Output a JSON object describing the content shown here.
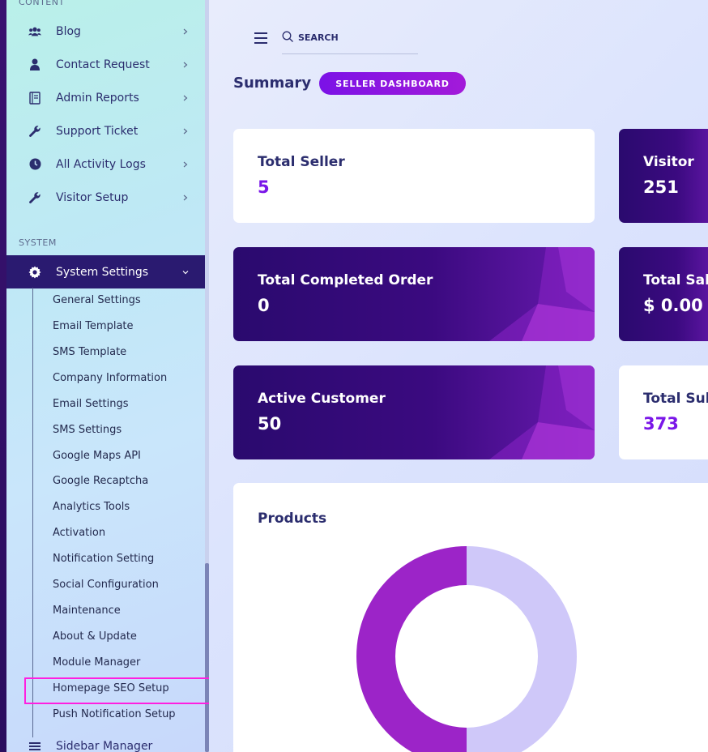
{
  "sidebar": {
    "content_label": "CONTENT",
    "system_label": "SYSTEM",
    "items": [
      {
        "label": "Blog",
        "icon": "users-icon"
      },
      {
        "label": "Contact Request",
        "icon": "user-icon"
      },
      {
        "label": "Admin Reports",
        "icon": "report-icon"
      },
      {
        "label": "Support Ticket",
        "icon": "wrench-icon"
      },
      {
        "label": "All Activity Logs",
        "icon": "clock-icon"
      },
      {
        "label": "Visitor Setup",
        "icon": "wrench-icon"
      }
    ],
    "system_settings": {
      "label": "System Settings",
      "icon": "gear-icon"
    },
    "sub_items": [
      "General Settings",
      "Email Template",
      "SMS Template",
      "Company Information",
      "Email Settings",
      "SMS Settings",
      "Google Maps API",
      "Google Recaptcha",
      "Analytics Tools",
      "Activation",
      "Notification Setting",
      "Social Configuration",
      "Maintenance",
      "About & Update",
      "Module Manager",
      "Homepage SEO Setup",
      "Push Notification Setup"
    ],
    "sidebar_manager": {
      "label": "Sidebar Manager",
      "icon": "menu-icon"
    }
  },
  "header": {
    "search_placeholder": "SEARCH"
  },
  "summary": {
    "title": "Summary",
    "badge": "SELLER DASHBOARD"
  },
  "cards": [
    {
      "title": "Total Seller",
      "value": "5"
    },
    {
      "title": "Visitor",
      "value": "251"
    },
    {
      "title": "Total Completed Order",
      "value": "0"
    },
    {
      "title": "Total Sale",
      "value": "$ 0.00"
    },
    {
      "title": "Active Customer",
      "value": "50"
    },
    {
      "title": "Total Sub",
      "value": "373"
    }
  ],
  "products": {
    "title": "Products",
    "colors": [
      "#9c24c8",
      "#cfc8f9"
    ]
  },
  "chart_data": {
    "type": "pie",
    "title": "Products",
    "values": [
      50,
      50
    ]
  }
}
